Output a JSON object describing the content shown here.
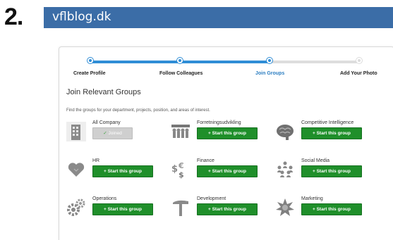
{
  "step_number": "2.",
  "site": {
    "name": "vflblog.dk"
  },
  "wizard": {
    "steps": [
      {
        "label": "Create Profile",
        "active": false,
        "done": true
      },
      {
        "label": "Follow Colleagues",
        "active": false,
        "done": true
      },
      {
        "label": "Join Groups",
        "active": true,
        "done": true
      },
      {
        "label": "Add Your Photo",
        "active": false,
        "done": false
      }
    ],
    "progress_fraction": 0.67
  },
  "heading": "Join Relevant Groups",
  "subheading": "Find the groups for your department, projects, position, and areas of interest.",
  "groups": [
    {
      "name": "All Company",
      "button": "Joined",
      "joined": true,
      "icon": "building-icon"
    },
    {
      "name": "Forretningsudvikling",
      "button": "+ Start this group",
      "joined": false,
      "icon": "people-meeting-icon"
    },
    {
      "name": "Competitive Intelligence",
      "button": "+ Start this group",
      "joined": false,
      "icon": "brain-icon"
    },
    {
      "name": "HR",
      "button": "+ Start this group",
      "joined": false,
      "icon": "heart-icon"
    },
    {
      "name": "Finance",
      "button": "+ Start this group",
      "joined": false,
      "icon": "money-icon"
    },
    {
      "name": "Social Media",
      "button": "+ Start this group",
      "joined": false,
      "icon": "social-network-icon"
    },
    {
      "name": "Operations",
      "button": "+ Start this group",
      "joined": false,
      "icon": "gears-icon"
    },
    {
      "name": "Development",
      "button": "+ Start this group",
      "joined": false,
      "icon": "hammer-icon"
    },
    {
      "name": "Marketing",
      "button": "+ Start this group",
      "joined": false,
      "icon": "starburst-icon"
    }
  ],
  "colors": {
    "site_bar": "#3b6da7",
    "progress": "#2f8dd6",
    "start_button": "#1f8f2a",
    "joined_button": "#cfcfcf"
  }
}
